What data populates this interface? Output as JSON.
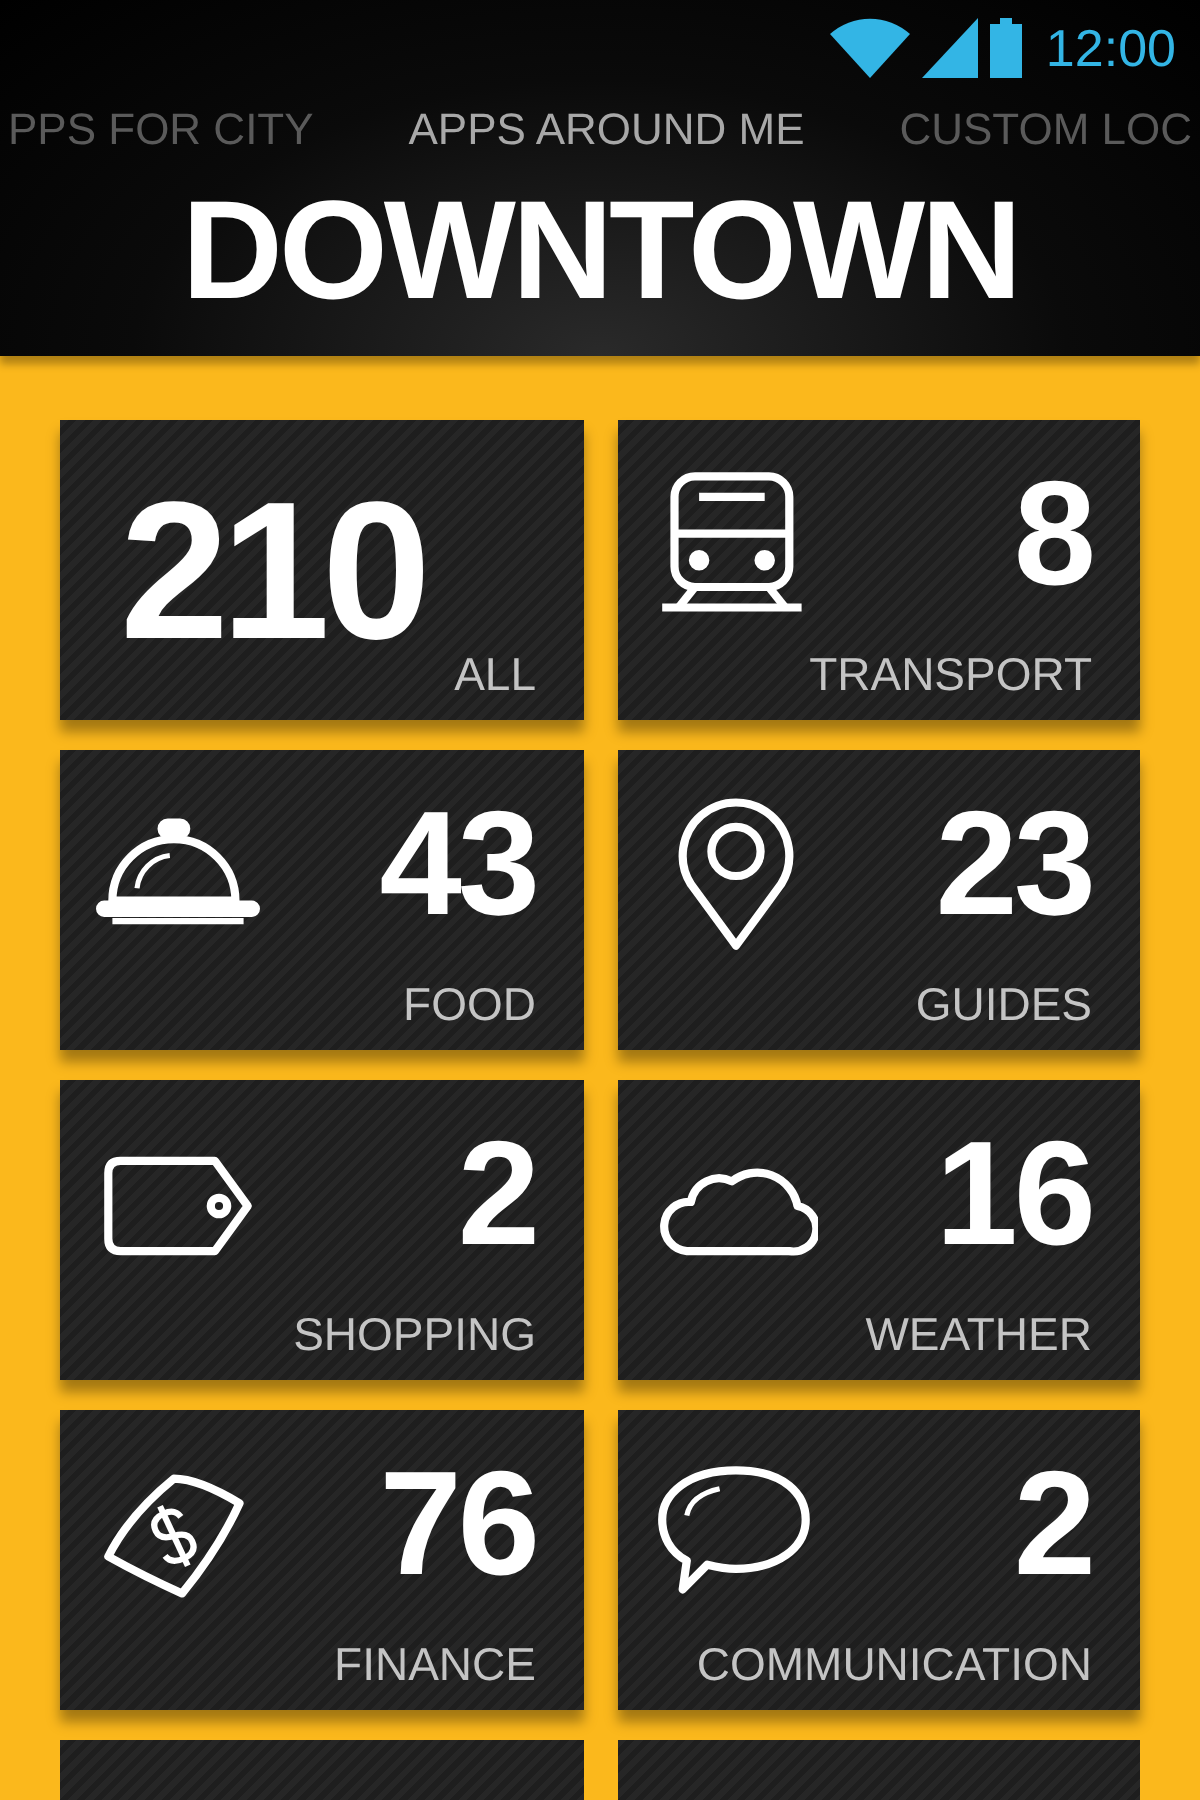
{
  "status_bar": {
    "time": "12:00"
  },
  "tabs": [
    {
      "label": "PPS FOR CITY",
      "selected": false
    },
    {
      "label": "APPS AROUND ME",
      "selected": true
    },
    {
      "label": "CUSTOM LOC",
      "selected": false
    }
  ],
  "title": "DOWNTOWN",
  "tiles": [
    {
      "kind": "total",
      "count": "210",
      "label": "ALL"
    },
    {
      "kind": "train",
      "count": "8",
      "label": "TRANSPORT"
    },
    {
      "kind": "cloche",
      "count": "43",
      "label": "FOOD"
    },
    {
      "kind": "pin",
      "count": "23",
      "label": "GUIDES"
    },
    {
      "kind": "tag",
      "count": "2",
      "label": "SHOPPING"
    },
    {
      "kind": "cloud",
      "count": "16",
      "label": "WEATHER"
    },
    {
      "kind": "banknote",
      "count": "76",
      "label": "FINANCE"
    },
    {
      "kind": "speech",
      "count": "2",
      "label": "COMMUNICATION"
    },
    {
      "kind": "cut"
    },
    {
      "kind": "cut"
    }
  ]
}
